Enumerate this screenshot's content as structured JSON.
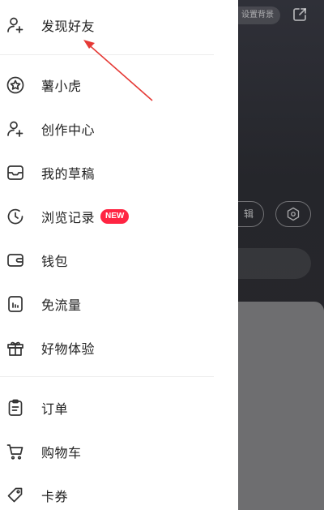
{
  "background_page": {
    "set_background_label": "设置背景",
    "edit_label": "辑"
  },
  "drawer": {
    "items": [
      {
        "id": "find-friends",
        "label": "发现好友",
        "icon": "add-user-icon"
      },
      {
        "id": "shu-xiao-hu",
        "label": "薯小虎",
        "icon": "star-badge-icon"
      },
      {
        "id": "creator-center",
        "label": "创作中心",
        "icon": "add-user-icon"
      },
      {
        "id": "my-drafts",
        "label": "我的草稿",
        "icon": "inbox-icon"
      },
      {
        "id": "history",
        "label": "浏览记录",
        "icon": "clock-icon",
        "badge": "NEW"
      },
      {
        "id": "wallet",
        "label": "钱包",
        "icon": "wallet-icon"
      },
      {
        "id": "free-data",
        "label": "免流量",
        "icon": "data-chart-icon"
      },
      {
        "id": "good-stuff",
        "label": "好物体验",
        "icon": "gift-icon"
      },
      {
        "id": "orders",
        "label": "订单",
        "icon": "clipboard-icon"
      },
      {
        "id": "cart",
        "label": "购物车",
        "icon": "cart-icon"
      },
      {
        "id": "coupons",
        "label": "卡券",
        "icon": "tag-icon"
      }
    ]
  },
  "colors": {
    "badge": "#ff2442",
    "arrow": "#e53935",
    "text": "#222222"
  }
}
